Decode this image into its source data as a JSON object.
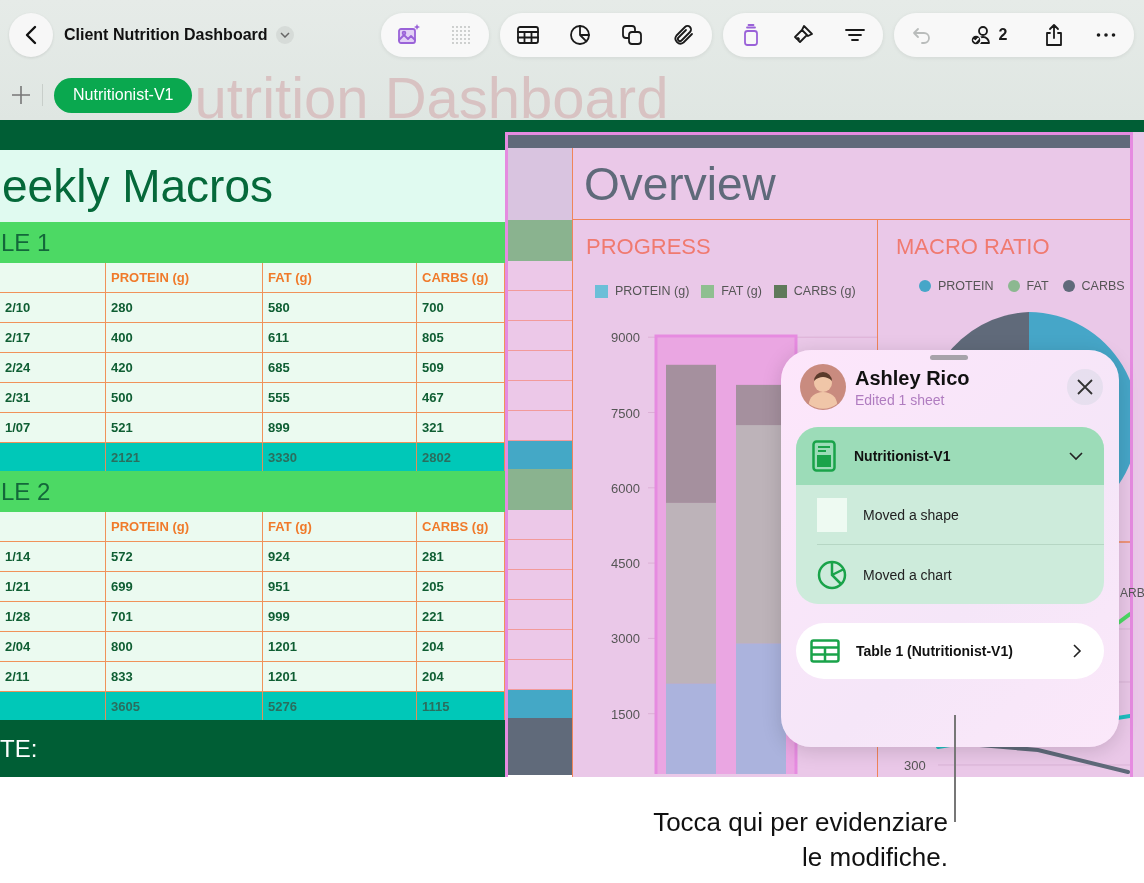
{
  "toolbar": {
    "title": "Client Nutrition Dashboard",
    "groups": [
      [
        {
          "kind": "media",
          "disabled": false
        },
        {
          "kind": "grid",
          "disabled": true
        }
      ],
      [
        {
          "kind": "table",
          "disabled": false
        },
        {
          "kind": "chart",
          "disabled": false
        },
        {
          "kind": "shape",
          "disabled": false
        },
        {
          "kind": "attach",
          "disabled": false
        }
      ],
      [
        {
          "kind": "format",
          "disabled": false
        },
        {
          "kind": "brush",
          "disabled": false
        },
        {
          "kind": "organize",
          "disabled": false
        }
      ],
      [
        {
          "kind": "undo",
          "disabled": true
        },
        {
          "kind": "collab",
          "disabled": false,
          "count": "2"
        },
        {
          "kind": "share",
          "disabled": false
        },
        {
          "kind": "more",
          "disabled": false
        }
      ]
    ]
  },
  "sheet_tabs": [
    {
      "label": "Nutritionist-V1",
      "selected": true
    }
  ],
  "background_title": "utrition Dashboard",
  "macros_table": {
    "title": "eekly Macros",
    "sections": [
      {
        "label": "LE 1",
        "columns": [
          "PROTEIN (g)",
          "FAT (g)",
          "CARBS (g)"
        ],
        "rows": [
          {
            "date": "2/10",
            "values": [
              "280",
              "580",
              "700"
            ]
          },
          {
            "date": "2/17",
            "values": [
              "400",
              "611",
              "805"
            ]
          },
          {
            "date": "2/24",
            "values": [
              "420",
              "685",
              "509"
            ]
          },
          {
            "date": "2/31",
            "values": [
              "500",
              "555",
              "467"
            ]
          },
          {
            "date": "1/07",
            "values": [
              "521",
              "899",
              "321"
            ]
          }
        ],
        "totals": [
          "2121",
          "3330",
          "2802"
        ]
      },
      {
        "label": "LE 2",
        "columns": [
          "PROTEIN (g)",
          "FAT (g)",
          "CARBS (g)"
        ],
        "rows": [
          {
            "date": "1/14",
            "values": [
              "572",
              "924",
              "281"
            ]
          },
          {
            "date": "1/21",
            "values": [
              "699",
              "951",
              "205"
            ]
          },
          {
            "date": "1/28",
            "values": [
              "701",
              "999",
              "221"
            ]
          },
          {
            "date": "2/04",
            "values": [
              "800",
              "1201",
              "204"
            ]
          },
          {
            "date": "2/11",
            "values": [
              "833",
              "1201",
              "204"
            ]
          }
        ],
        "totals": [
          "3605",
          "5276",
          "1115"
        ]
      }
    ],
    "footer_label": "TE:"
  },
  "overview": {
    "title": "Overview",
    "progress": {
      "title": "PROGRESS",
      "chart_data": {
        "type": "bar",
        "stacked": true,
        "grid": true,
        "ylim": [
          0,
          9000
        ],
        "yticks": [
          1500,
          3000,
          4500,
          6000,
          7500,
          9000
        ],
        "series": [
          {
            "name": "PROTEIN (g)",
            "color": "#6cbfd8",
            "values": [
              2100,
              2900
            ]
          },
          {
            "name": "FAT (g)",
            "color": "#8fbf90",
            "values": [
              3600,
              4350
            ]
          },
          {
            "name": "CARBS (g)",
            "color": "#5f7a5a",
            "values": [
              2750,
              800
            ]
          }
        ]
      }
    },
    "macro_ratio": {
      "title": "MACRO RATIO",
      "legend": [
        {
          "label": "PROTEIN",
          "color": "#46a6c8"
        },
        {
          "label": "FAT",
          "color": "#8cb890"
        },
        {
          "label": "CARBS",
          "color": "#606a7a"
        }
      ]
    },
    "line_chart": {
      "legend_fragment": "ARB",
      "tick": "300"
    }
  },
  "popover": {
    "name": "Ashley Rico",
    "subtitle": "Edited 1 sheet",
    "sheet": {
      "label": "Nutritionist-V1",
      "expanded": true,
      "changes": [
        {
          "kind": "shape",
          "label": "Moved a shape"
        },
        {
          "kind": "chart",
          "label": "Moved a chart"
        }
      ]
    },
    "link": {
      "label": "Table 1 (Nutritionist-V1)"
    }
  },
  "callout": {
    "lines": [
      "Tocca qui per evidenziare",
      "le modifiche."
    ]
  }
}
